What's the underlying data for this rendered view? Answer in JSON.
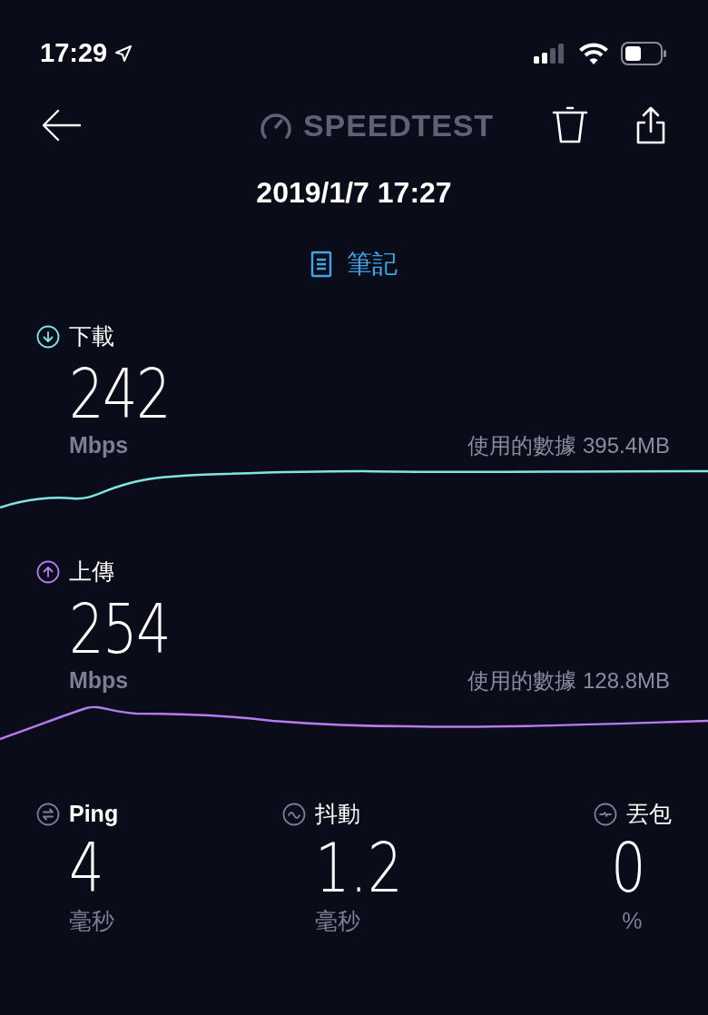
{
  "status_bar": {
    "time": "17:29"
  },
  "header": {
    "logo": "SPEEDTEST",
    "date": "2019/1/7 17:27",
    "notes_link": "筆記"
  },
  "metrics": [
    {
      "kind": "download",
      "label": "下載",
      "value": "242",
      "unit": "Mbps",
      "data_used": "使用的數據 395.4MB",
      "color": "#7ee8e0"
    },
    {
      "kind": "upload",
      "label": "上傳",
      "value": "254",
      "unit": "Mbps",
      "data_used": "使用的數據 128.8MB",
      "color": "#b57cf0"
    }
  ],
  "stats": [
    {
      "kind": "ping",
      "label": "Ping",
      "value": "4",
      "unit": "毫秒"
    },
    {
      "kind": "jitter",
      "label": "抖動",
      "value": "1.2",
      "unit": "毫秒"
    },
    {
      "kind": "loss",
      "label": "丟包",
      "value": "0",
      "unit": "%"
    }
  ]
}
